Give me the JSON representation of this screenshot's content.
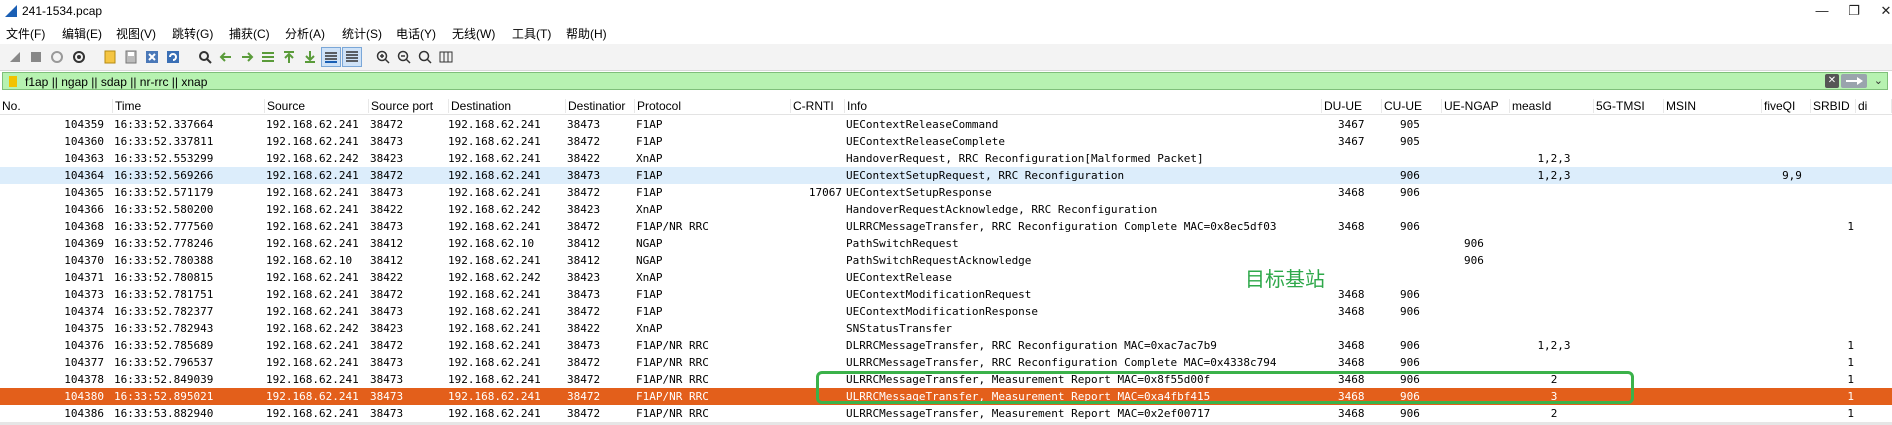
{
  "window": {
    "title": "241-1534.pcap",
    "controls": [
      "—",
      "❐",
      "✕"
    ]
  },
  "menu": [
    "文件(F)",
    "编辑(E)",
    "视图(V)",
    "跳转(G)",
    "捕获(C)",
    "分析(A)",
    "统计(S)",
    "电话(Y)",
    "无线(W)",
    "工具(T)",
    "帮助(H)"
  ],
  "toolbar": [
    "start-capture-icon",
    "stop-capture-icon",
    "restart-capture-icon",
    "capture-options-icon",
    "open-file-icon",
    "save-file-icon",
    "close-file-icon",
    "reload-file-icon",
    "find-packet-icon",
    "go-back-icon",
    "go-forward-icon",
    "go-to-packet-icon",
    "go-first-icon",
    "go-last-icon",
    "autoscroll-icon",
    "colorize-icon",
    "zoom-in-icon",
    "zoom-out-icon",
    "zoom-normal-icon",
    "resize-columns-icon"
  ],
  "filter": {
    "value": "f1ap || ngap || sdap || nr-rrc || xnap"
  },
  "columns": [
    "No.",
    "Time",
    "Source",
    "Source port",
    "Destination",
    "Destinatior",
    "Protocol",
    "C-RNTI",
    "Info",
    "DU-UE",
    "CU-UE",
    "UE-NGAP",
    "measId",
    "5G-TMSI",
    "MSIN",
    "fiveQI",
    "SRBID",
    "di"
  ],
  "packets": [
    {
      "no": "104359",
      "time": "16:33:52.337664",
      "src": "192.168.62.241",
      "sport": "38472",
      "dst": "192.168.62.241",
      "dport": "38473",
      "proto": "F1AP",
      "crnti": "",
      "info": "UEContextReleaseCommand",
      "duue": "3467",
      "cuue": "905",
      "uengap": "",
      "measid": "",
      "tmsi": "",
      "msin": "",
      "fiveqi": "",
      "srbid": ""
    },
    {
      "no": "104360",
      "time": "16:33:52.337811",
      "src": "192.168.62.241",
      "sport": "38473",
      "dst": "192.168.62.241",
      "dport": "38472",
      "proto": "F1AP",
      "crnti": "",
      "info": "UEContextReleaseComplete",
      "duue": "3467",
      "cuue": "905",
      "uengap": "",
      "measid": "",
      "tmsi": "",
      "msin": "",
      "fiveqi": "",
      "srbid": ""
    },
    {
      "no": "104363",
      "time": "16:33:52.553299",
      "src": "192.168.62.242",
      "sport": "38423",
      "dst": "192.168.62.241",
      "dport": "38422",
      "proto": "XnAP",
      "crnti": "",
      "info": "HandoverRequest, RRC Reconfiguration[Malformed Packet]",
      "duue": "",
      "cuue": "",
      "uengap": "",
      "measid": "1,2,3",
      "tmsi": "",
      "msin": "",
      "fiveqi": "",
      "srbid": ""
    },
    {
      "no": "104364",
      "time": "16:33:52.569266",
      "src": "192.168.62.241",
      "sport": "38472",
      "dst": "192.168.62.241",
      "dport": "38473",
      "proto": "F1AP",
      "crnti": "",
      "info": "UEContextSetupRequest, RRC Reconfiguration",
      "duue": "",
      "cuue": "906",
      "uengap": "",
      "measid": "1,2,3",
      "tmsi": "",
      "msin": "",
      "fiveqi": "9,9",
      "srbid": ""
    },
    {
      "no": "104365",
      "time": "16:33:52.571179",
      "src": "192.168.62.241",
      "sport": "38473",
      "dst": "192.168.62.241",
      "dport": "38472",
      "proto": "F1AP",
      "crnti": "17067",
      "info": "UEContextSetupResponse",
      "duue": "3468",
      "cuue": "906",
      "uengap": "",
      "measid": "",
      "tmsi": "",
      "msin": "",
      "fiveqi": "",
      "srbid": ""
    },
    {
      "no": "104366",
      "time": "16:33:52.580200",
      "src": "192.168.62.241",
      "sport": "38422",
      "dst": "192.168.62.242",
      "dport": "38423",
      "proto": "XnAP",
      "crnti": "",
      "info": "HandoverRequestAcknowledge, RRC Reconfiguration",
      "duue": "",
      "cuue": "",
      "uengap": "",
      "measid": "",
      "tmsi": "",
      "msin": "",
      "fiveqi": "",
      "srbid": ""
    },
    {
      "no": "104368",
      "time": "16:33:52.777560",
      "src": "192.168.62.241",
      "sport": "38473",
      "dst": "192.168.62.241",
      "dport": "38472",
      "proto": "F1AP/NR RRC",
      "crnti": "",
      "info": "ULRRCMessageTransfer, RRC Reconfiguration Complete MAC=0x8ec5df03",
      "duue": "3468",
      "cuue": "906",
      "uengap": "",
      "measid": "",
      "tmsi": "",
      "msin": "",
      "fiveqi": "",
      "srbid": "1"
    },
    {
      "no": "104369",
      "time": "16:33:52.778246",
      "src": "192.168.62.241",
      "sport": "38412",
      "dst": "192.168.62.10",
      "dport": "38412",
      "proto": "NGAP",
      "crnti": "",
      "info": "PathSwitchRequest",
      "duue": "",
      "cuue": "",
      "uengap": "906",
      "measid": "",
      "tmsi": "",
      "msin": "",
      "fiveqi": "",
      "srbid": ""
    },
    {
      "no": "104370",
      "time": "16:33:52.780388",
      "src": "192.168.62.10",
      "sport": "38412",
      "dst": "192.168.62.241",
      "dport": "38412",
      "proto": "NGAP",
      "crnti": "",
      "info": "PathSwitchRequestAcknowledge",
      "duue": "",
      "cuue": "",
      "uengap": "906",
      "measid": "",
      "tmsi": "",
      "msin": "",
      "fiveqi": "",
      "srbid": ""
    },
    {
      "no": "104371",
      "time": "16:33:52.780815",
      "src": "192.168.62.241",
      "sport": "38422",
      "dst": "192.168.62.242",
      "dport": "38423",
      "proto": "XnAP",
      "crnti": "",
      "info": "UEContextRelease",
      "duue": "",
      "cuue": "",
      "uengap": "",
      "measid": "",
      "tmsi": "",
      "msin": "",
      "fiveqi": "",
      "srbid": ""
    },
    {
      "no": "104373",
      "time": "16:33:52.781751",
      "src": "192.168.62.241",
      "sport": "38472",
      "dst": "192.168.62.241",
      "dport": "38473",
      "proto": "F1AP",
      "crnti": "",
      "info": "UEContextModificationRequest",
      "duue": "3468",
      "cuue": "906",
      "uengap": "",
      "measid": "",
      "tmsi": "",
      "msin": "",
      "fiveqi": "",
      "srbid": ""
    },
    {
      "no": "104374",
      "time": "16:33:52.782377",
      "src": "192.168.62.241",
      "sport": "38473",
      "dst": "192.168.62.241",
      "dport": "38472",
      "proto": "F1AP",
      "crnti": "",
      "info": "UEContextModificationResponse",
      "duue": "3468",
      "cuue": "906",
      "uengap": "",
      "measid": "",
      "tmsi": "",
      "msin": "",
      "fiveqi": "",
      "srbid": ""
    },
    {
      "no": "104375",
      "time": "16:33:52.782943",
      "src": "192.168.62.242",
      "sport": "38423",
      "dst": "192.168.62.241",
      "dport": "38422",
      "proto": "XnAP",
      "crnti": "",
      "info": "SNStatusTransfer",
      "duue": "",
      "cuue": "",
      "uengap": "",
      "measid": "",
      "tmsi": "",
      "msin": "",
      "fiveqi": "",
      "srbid": ""
    },
    {
      "no": "104376",
      "time": "16:33:52.785689",
      "src": "192.168.62.241",
      "sport": "38472",
      "dst": "192.168.62.241",
      "dport": "38473",
      "proto": "F1AP/NR RRC",
      "crnti": "",
      "info": "DLRRCMessageTransfer, RRC Reconfiguration MAC=0xac7ac7b9",
      "duue": "3468",
      "cuue": "906",
      "uengap": "",
      "measid": "1,2,3",
      "tmsi": "",
      "msin": "",
      "fiveqi": "",
      "srbid": "1"
    },
    {
      "no": "104377",
      "time": "16:33:52.796537",
      "src": "192.168.62.241",
      "sport": "38473",
      "dst": "192.168.62.241",
      "dport": "38472",
      "proto": "F1AP/NR RRC",
      "crnti": "",
      "info": "ULRRCMessageTransfer, RRC Reconfiguration Complete MAC=0x4338c794",
      "duue": "3468",
      "cuue": "906",
      "uengap": "",
      "measid": "",
      "tmsi": "",
      "msin": "",
      "fiveqi": "",
      "srbid": "1"
    },
    {
      "no": "104378",
      "time": "16:33:52.849039",
      "src": "192.168.62.241",
      "sport": "38473",
      "dst": "192.168.62.241",
      "dport": "38472",
      "proto": "F1AP/NR RRC",
      "crnti": "",
      "info": "ULRRCMessageTransfer, Measurement Report MAC=0x8f55d00f",
      "duue": "3468",
      "cuue": "906",
      "uengap": "",
      "measid": "2",
      "tmsi": "",
      "msin": "",
      "fiveqi": "",
      "srbid": "1"
    },
    {
      "no": "104380",
      "time": "16:33:52.895021",
      "src": "192.168.62.241",
      "sport": "38473",
      "dst": "192.168.62.241",
      "dport": "38472",
      "proto": "F1AP/NR RRC",
      "crnti": "",
      "info": "ULRRCMessageTransfer, Measurement Report MAC=0xa4fbf415",
      "duue": "3468",
      "cuue": "906",
      "uengap": "",
      "measid": "3",
      "tmsi": "",
      "msin": "",
      "fiveqi": "",
      "srbid": "1"
    },
    {
      "no": "104386",
      "time": "16:33:53.882940",
      "src": "192.168.62.241",
      "sport": "38473",
      "dst": "192.168.62.241",
      "dport": "38472",
      "proto": "F1AP/NR RRC",
      "crnti": "",
      "info": "ULRRCMessageTransfer, Measurement Report MAC=0x2ef00717",
      "duue": "3468",
      "cuue": "906",
      "uengap": "",
      "measid": "2",
      "tmsi": "",
      "msin": "",
      "fiveqi": "",
      "srbid": "1"
    }
  ],
  "selection": {
    "selected_no": "104380",
    "related_no": "104364"
  },
  "annotation": {
    "label": "目标基站",
    "color": "#2ea84a"
  },
  "colors": {
    "selected": "#e35f1b",
    "related": "#dcedfb",
    "filter_ok": "#b7f2b1"
  }
}
